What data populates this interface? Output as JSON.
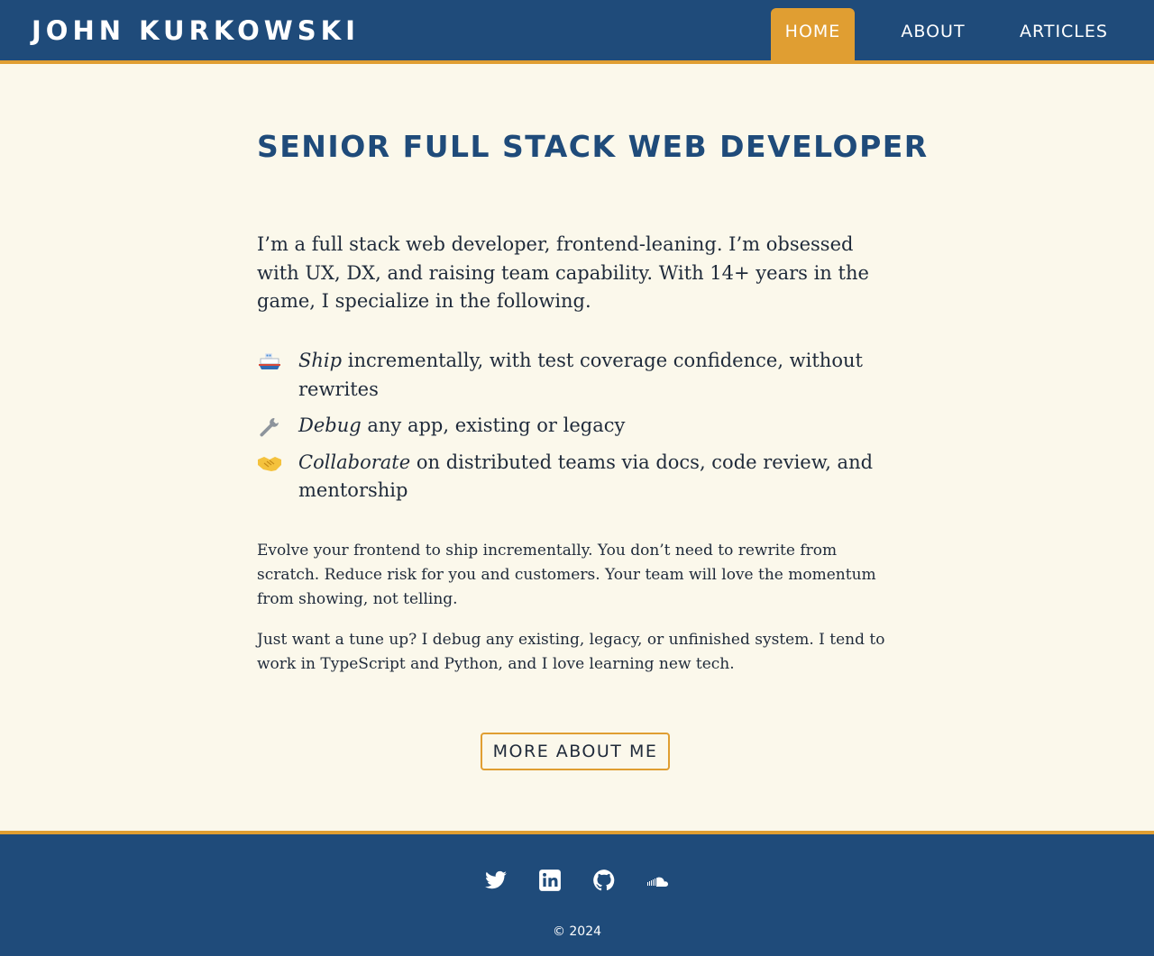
{
  "header": {
    "brand": "JOHN KURKOWSKI",
    "nav": [
      {
        "label": "HOME",
        "active": true
      },
      {
        "label": "ABOUT",
        "active": false
      },
      {
        "label": "ARTICLES",
        "active": false
      }
    ]
  },
  "main": {
    "heading": "SENIOR FULL STACK WEB DEVELOPER",
    "intro": "I’m a full stack web developer, frontend-leaning. I’m obsessed with UX, DX, and raising team capability. With 14+ years in the game, I specialize in the following.",
    "skills": [
      {
        "icon": "ship-icon",
        "emphasis": "Ship",
        "text": " incrementally, with test coverage confidence, without rewrites"
      },
      {
        "icon": "wrench-icon",
        "emphasis": "Debug",
        "text": " any app, existing or legacy"
      },
      {
        "icon": "handshake-icon",
        "emphasis": "Collaborate",
        "text": " on distributed teams via docs, code review, and mentorship"
      }
    ],
    "paragraphs": [
      "Evolve your frontend to ship incrementally. You don’t need to rewrite from scratch. Reduce risk for you and customers. Your team will love the momentum from showing, not telling.",
      "Just want a tune up? I debug any existing, legacy, or unfinished system. I tend to work in TypeScript and Python, and I love learning new tech."
    ],
    "cta_label": "MORE ABOUT ME"
  },
  "footer": {
    "social": [
      {
        "icon": "twitter-icon"
      },
      {
        "icon": "linkedin-icon"
      },
      {
        "icon": "github-icon"
      },
      {
        "icon": "soundcloud-icon"
      }
    ],
    "copyright": "© 2024"
  },
  "colors": {
    "header_bg": "#1f4b7a",
    "accent": "#e09e32",
    "page_bg": "#fbf8eb",
    "heading": "#1f4b7a",
    "text": "#1f2a3a"
  }
}
